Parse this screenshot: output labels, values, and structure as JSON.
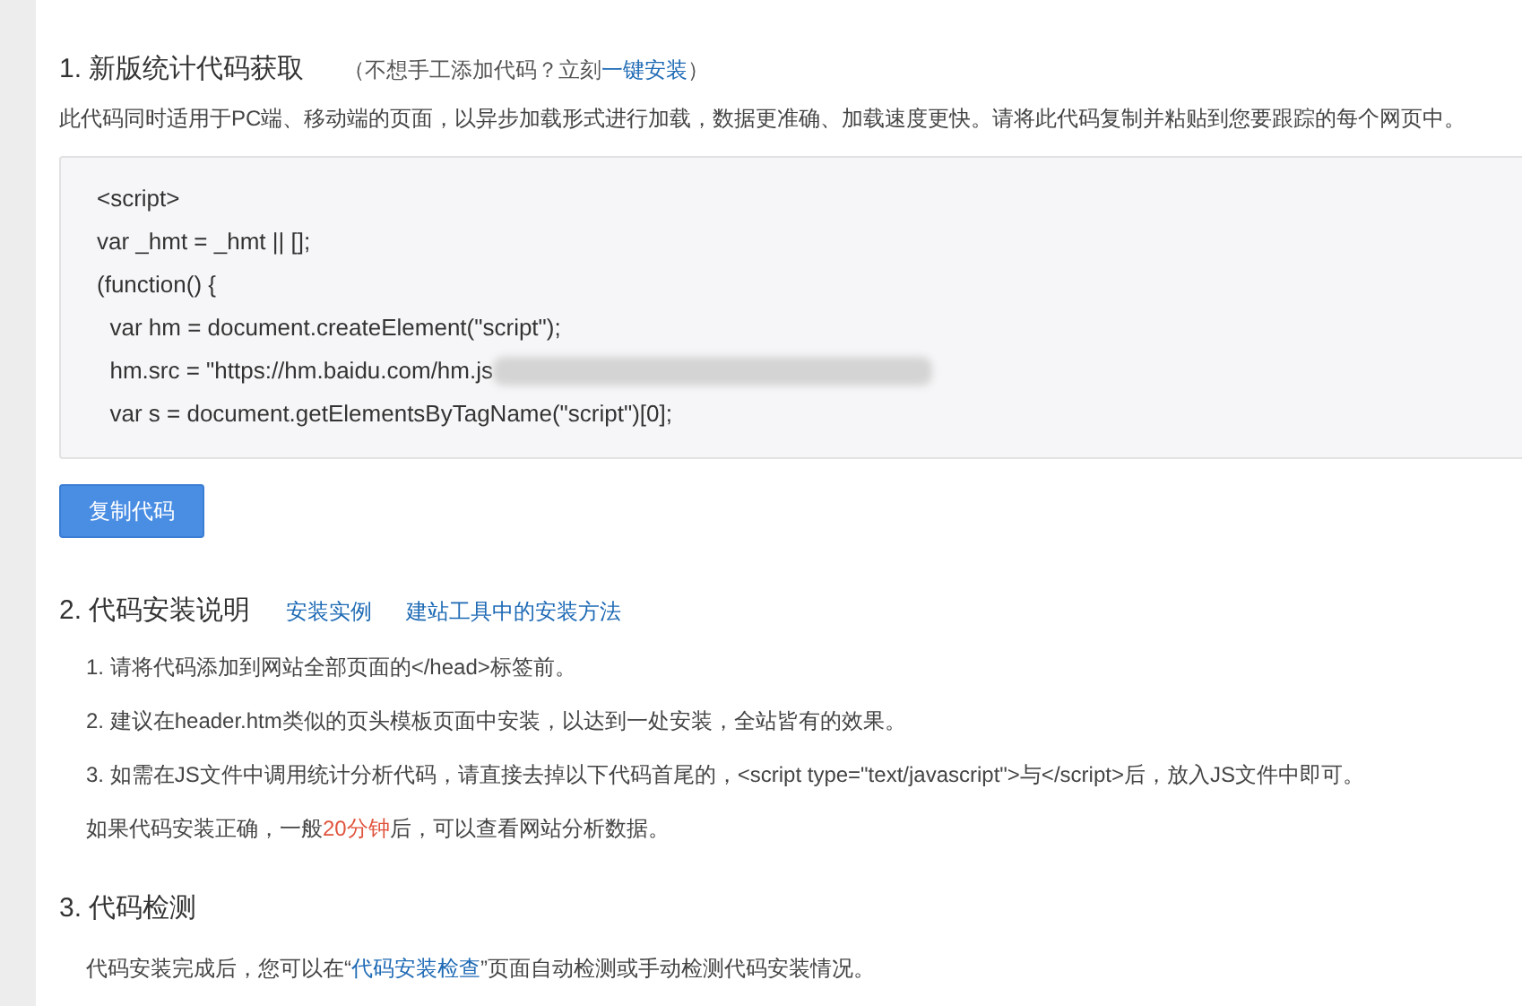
{
  "section_1": {
    "heading": "1. 新版统计代码获取",
    "hint": [
      {
        "kind": "plain",
        "text": "（不想手工添加代码？立刻"
      },
      {
        "kind": "link",
        "text": "一键安装"
      },
      {
        "kind": "plain",
        "text": "）"
      }
    ],
    "description": "此代码同时适用于PC端、移动端的页面，以异步加载形式进行加载，数据更准确、加载速度更快。请将此代码复制并粘贴到您要跟踪的每个网页中。",
    "code_lines": [
      {
        "text": "<script>"
      },
      {
        "text": "var _hmt = _hmt || [];"
      },
      {
        "text": "(function() {"
      },
      {
        "text": "  var hm = document.createElement(\"script\");"
      },
      {
        "text": "  hm.src = \"https://hm.baidu.com/hm.js",
        "redacted": true
      },
      {
        "text": "  var s = document.getElementsByTagName(\"script\")[0];"
      }
    ],
    "copy_button": "复制代码"
  },
  "section_2": {
    "heading": "2. 代码安装说明",
    "links": [
      "安装实例",
      "建站工具中的安装方法"
    ],
    "steps": [
      "1. 请将代码添加到网站全部页面的</head>标签前。",
      "2. 建议在header.htm类似的页头模板页面中安装，以达到一处安装，全站皆有的效果。",
      "3. 如需在JS文件中调用统计分析代码，请直接去掉以下代码首尾的，<script type=\"text/javascript\">与</script>后，放入JS文件中即可。"
    ],
    "note": [
      {
        "kind": "plain",
        "text": "如果代码安装正确，一般"
      },
      {
        "kind": "highlight",
        "text": "20分钟"
      },
      {
        "kind": "plain",
        "text": "后，可以查看网站分析数据。"
      }
    ]
  },
  "section_3": {
    "heading": "3. 代码检测",
    "text": [
      {
        "kind": "plain",
        "text": "代码安装完成后，您可以在“"
      },
      {
        "kind": "link",
        "text": "代码安装检查"
      },
      {
        "kind": "plain",
        "text": "”页面自动检测或手动检测代码安装情况。"
      }
    ]
  }
}
